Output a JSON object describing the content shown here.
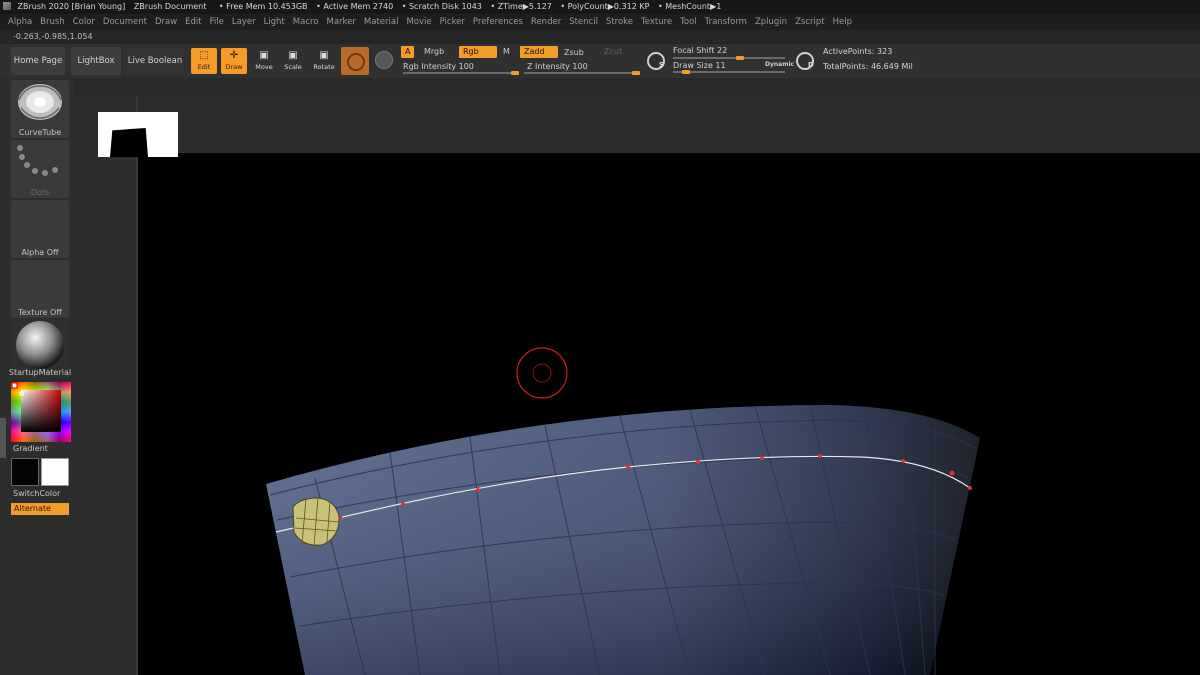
{
  "titlebar": {
    "app": "ZBrush 2020 [Brian Young]",
    "doc": "ZBrush Document",
    "free_mem": "• Free Mem 10.453GB",
    "active_mem": "• Active Mem 2740",
    "scratch": "• Scratch Disk 1043",
    "ztime": "• ZTime▶5.127",
    "polycount": "• PolyCount▶0.312 KP",
    "meshcount": "• MeshCount▶1"
  },
  "menu": [
    "Alpha",
    "Brush",
    "Color",
    "Document",
    "Draw",
    "Edit",
    "File",
    "Layer",
    "Light",
    "Macro",
    "Marker",
    "Material",
    "Movie",
    "Picker",
    "Preferences",
    "Render",
    "Stencil",
    "Stroke",
    "Texture",
    "Tool",
    "Transform",
    "Zplugin",
    "Zscript",
    "Help"
  ],
  "coords": "-0.263,-0.985,1.054",
  "toolbar": {
    "home": "Home Page",
    "lightbox": "LightBox",
    "live_boolean": "Live Boolean",
    "tools": [
      {
        "label": "Edit",
        "icon": "edit-icon",
        "active": true
      },
      {
        "label": "Draw",
        "icon": "draw-icon",
        "active": true
      },
      {
        "label": "Move",
        "icon": "move-icon",
        "active": false
      },
      {
        "label": "Scale",
        "icon": "scale-icon",
        "active": false
      },
      {
        "label": "Rotate",
        "icon": "rotate-icon",
        "active": false
      }
    ],
    "a": "A",
    "mrgb": "Mrgb",
    "rgb": "Rgb",
    "m": "M",
    "zadd": "Zadd",
    "zsub": "Zsub",
    "zcut": "Zcut",
    "rgb_intensity": "Rgb Intensity 100",
    "z_intensity": "Z Intensity 100",
    "focal_shift": "Focal Shift 22",
    "draw_size": "Draw Size 11",
    "dynamic": "Dynamic",
    "sym_s": "S",
    "sym_d": "D",
    "active_points": "ActivePoints: 323",
    "total_points": "TotalPoints: 46.649 Mil",
    "rgb_intensity_value": 100,
    "z_intensity_value": 100,
    "focal_shift_value": 22,
    "draw_size_value": 11
  },
  "sidebar": {
    "brush": "CurveTube",
    "stroke": "Dots",
    "alpha": "Alpha Off",
    "texture": "Texture Off",
    "material": "StartupMaterial",
    "gradient": "Gradient",
    "switch_color": "SwitchColor",
    "alternate": "Alternate"
  },
  "colors": {
    "accent": "#f59b2a",
    "mesh": "#4a5a7e",
    "curve": "#e8e8e8",
    "curve_point": "#e53030",
    "brush_cursor": "#d01c1c"
  }
}
